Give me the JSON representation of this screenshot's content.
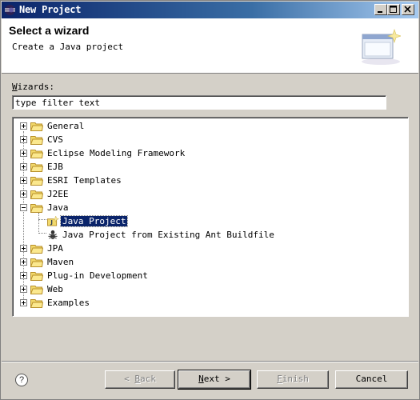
{
  "window": {
    "title": "New Project",
    "controls": [
      "minimize",
      "maximize",
      "close"
    ]
  },
  "header": {
    "title": "Select a wizard",
    "description": "Create a Java project",
    "image_icon": "wizard-banner-icon"
  },
  "wizards": {
    "label_prefix": "W",
    "label_rest": "izards:",
    "filter_value": "type filter text"
  },
  "tree": {
    "items": [
      {
        "label": "General",
        "expanded": false,
        "level": 0
      },
      {
        "label": "CVS",
        "expanded": false,
        "level": 0
      },
      {
        "label": "Eclipse Modeling Framework",
        "expanded": false,
        "level": 0
      },
      {
        "label": "EJB",
        "expanded": false,
        "level": 0
      },
      {
        "label": "ESRI Templates",
        "expanded": false,
        "level": 0
      },
      {
        "label": "J2EE",
        "expanded": false,
        "level": 0
      },
      {
        "label": "Java",
        "expanded": true,
        "level": 0
      },
      {
        "label": "Java Project",
        "level": 1,
        "selected": true,
        "icon": "java-project-icon"
      },
      {
        "label": "Java Project from Existing Ant Buildfile",
        "level": 1,
        "icon": "ant-icon"
      },
      {
        "label": "JPA",
        "expanded": false,
        "level": 0
      },
      {
        "label": "Maven",
        "expanded": false,
        "level": 0
      },
      {
        "label": "Plug-in Development",
        "expanded": false,
        "level": 0
      },
      {
        "label": "Web",
        "expanded": false,
        "level": 0
      },
      {
        "label": "Examples",
        "expanded": false,
        "level": 0
      }
    ]
  },
  "buttons": {
    "help": "?",
    "back_lt": "< ",
    "back_mn": "B",
    "back_rest": "ack",
    "next_mn": "N",
    "next_rest": "ext >",
    "finish_mn": "F",
    "finish_rest": "inish",
    "cancel": "Cancel"
  },
  "colors": {
    "selection": "#0a246a",
    "titlebar_start": "#0a246a",
    "titlebar_end": "#a6caf0",
    "dialog_bg": "#d4d0c8"
  }
}
